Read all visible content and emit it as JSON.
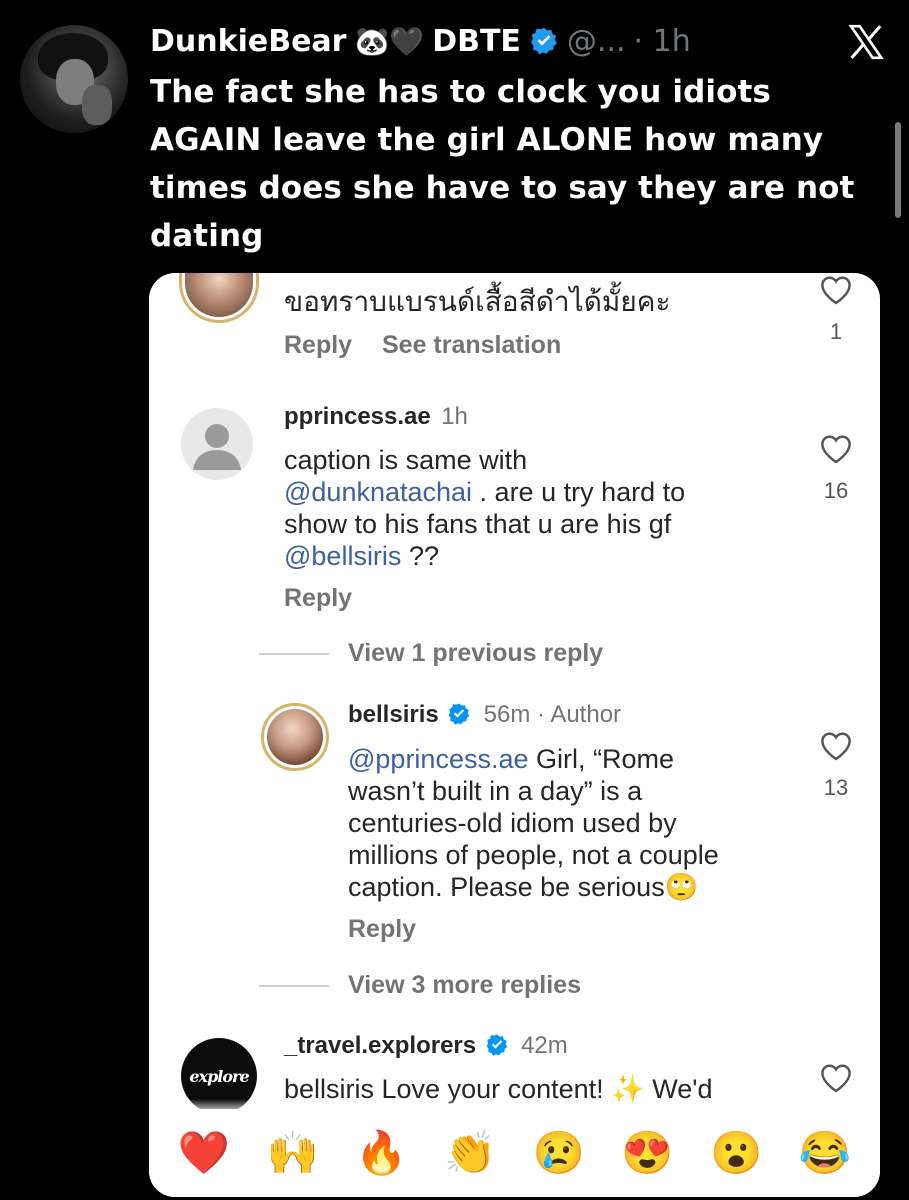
{
  "tweet": {
    "display_name": "DunkieBear",
    "name_emojis": "🐼🖤",
    "name_suffix": "DBTE",
    "handle": "@...",
    "time": "· 1h",
    "text": "The fact she has to clock you idiots AGAIN leave the girl ALONE how many times does she have to say they are not dating"
  },
  "comments": {
    "c0": {
      "text": "ขอทราบแบรนด์เสื้อสีดำได้มั้ยคะ",
      "reply": "Reply",
      "see_translation": "See translation",
      "likes": "1"
    },
    "c1": {
      "user": "pprincess.ae",
      "time": "1h",
      "line1": "caption is same with",
      "mention1": "@dunknatachai",
      "line2": " . are u try hard to",
      "line3": "show to his fans that u are his gf",
      "mention2": "@bellsiris",
      "line4": " ??",
      "reply": "Reply",
      "likes": "16"
    },
    "view_previous": "View 1 previous reply",
    "c2": {
      "user": "bellsiris",
      "time": "56m · Author",
      "mention": "@pprincess.ae",
      "line1": " Girl, “Rome",
      "line2": "wasn’t built in a day” is a",
      "line3": "centuries-old idiom used by",
      "line4": "millions of people, not a couple",
      "line5": "caption. Please be serious🙄",
      "reply": "Reply",
      "likes": "13"
    },
    "view_more": "View 3 more replies",
    "c3": {
      "user": "_travel.explorers",
      "time": "42m",
      "line1": "bellsiris Love your content! ✨ We'd",
      "avatar_text": "explore"
    }
  },
  "reactions": [
    "❤️",
    "🙌",
    "🔥",
    "👏",
    "😢",
    "😍",
    "😮",
    "😂"
  ],
  "colors": {
    "background": "#000000",
    "verified": "#1d9bf0",
    "ig_verified": "#0095f6",
    "mention": "#3d5fa3"
  },
  "icons": [
    "x-logo-icon",
    "verified-badge-icon",
    "heart-icon",
    "default-avatar-icon"
  ]
}
